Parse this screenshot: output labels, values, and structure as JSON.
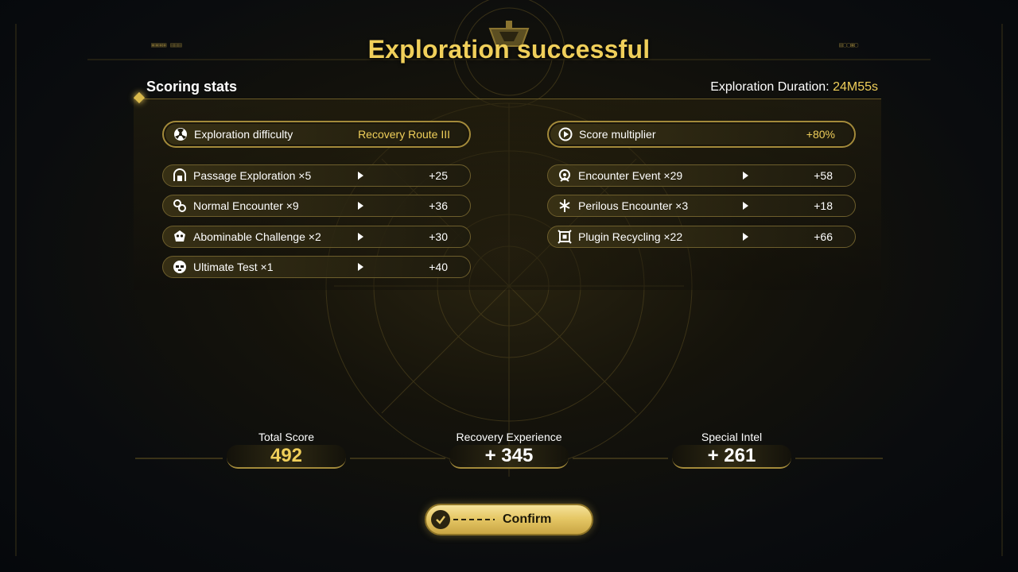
{
  "title": "Exploration successful",
  "scoring": {
    "section_title": "Scoring stats",
    "duration_label": "Exploration Duration:",
    "duration_value": "24M55s",
    "difficulty": {
      "label": "Exploration difficulty",
      "value": "Recovery Route III",
      "icon": "radiation-icon"
    },
    "multiplier": {
      "label": "Score multiplier",
      "value": "+80%",
      "icon": "play-circle-icon"
    },
    "left_items": [
      {
        "label": "Passage Exploration ×5",
        "value": "+25",
        "icon": "passage-icon"
      },
      {
        "label": "Normal Encounter ×9",
        "value": "+36",
        "icon": "encounter-icon"
      },
      {
        "label": "Abominable Challenge ×2",
        "value": "+30",
        "icon": "skull-icon"
      },
      {
        "label": "Ultimate Test ×1",
        "value": "+40",
        "icon": "mask-icon"
      }
    ],
    "right_items": [
      {
        "label": "Encounter Event ×29",
        "value": "+58",
        "icon": "event-icon"
      },
      {
        "label": "Perilous Encounter ×3",
        "value": "+18",
        "icon": "perilous-icon"
      },
      {
        "label": "Plugin Recycling ×22",
        "value": "+66",
        "icon": "plugin-icon"
      }
    ]
  },
  "totals": {
    "total_score": {
      "label": "Total Score",
      "value": "492"
    },
    "recovery_experience": {
      "label": "Recovery Experience",
      "value": "+ 345"
    },
    "special_intel": {
      "label": "Special Intel",
      "value": "+ 261"
    }
  },
  "confirm_label": "Confirm",
  "colors": {
    "gold": "#f0cf5a",
    "background": "#0a0c0e",
    "button": "#e6c866"
  }
}
